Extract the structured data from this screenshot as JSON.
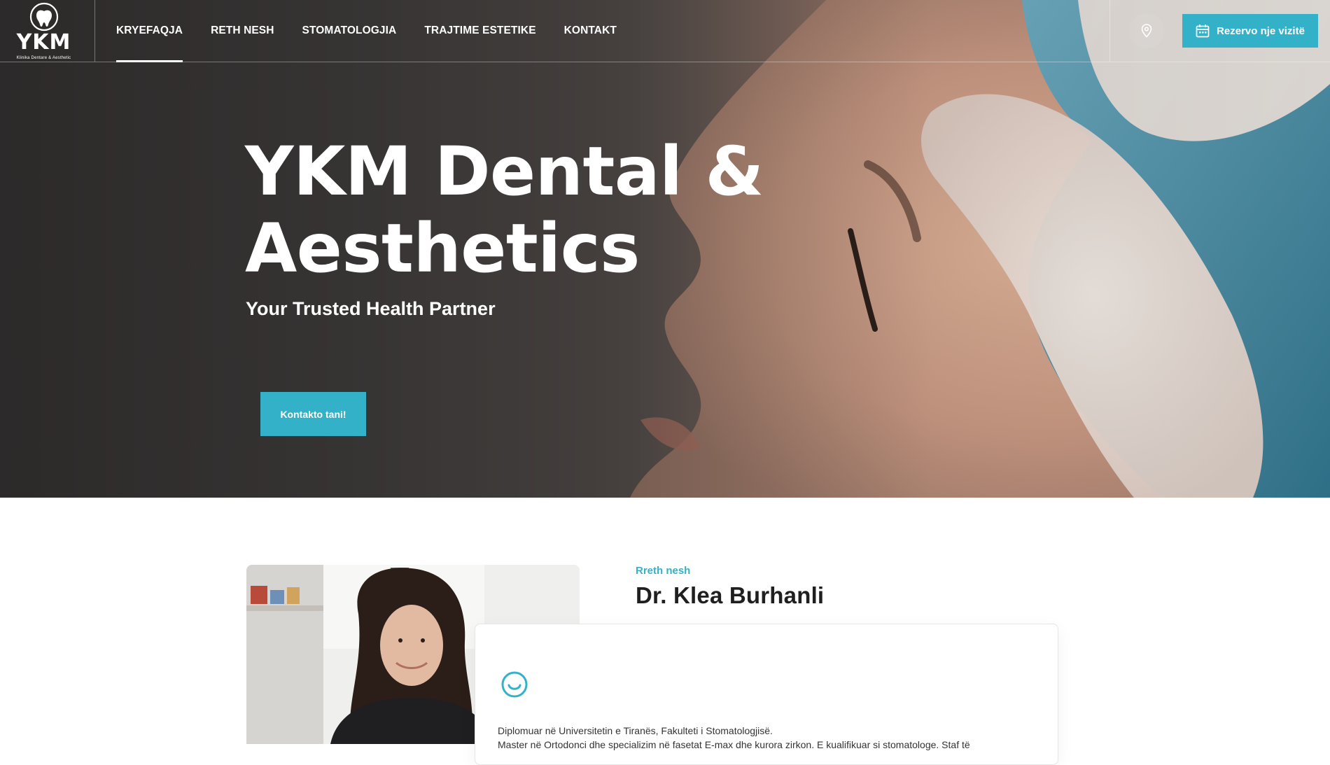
{
  "brand": {
    "logo_text": "YKM",
    "logo_sub": "Klinika Dentare & Aesthetic",
    "accent_color": "#33b1c9"
  },
  "nav": {
    "items": [
      {
        "label": "KRYEFAQJA",
        "active": true
      },
      {
        "label": "RETH NESH",
        "active": false
      },
      {
        "label": "STOMATOLOGJIA",
        "active": false
      },
      {
        "label": "TRAJTIME ESTETIKE",
        "active": false
      },
      {
        "label": "KONTAKT",
        "active": false
      }
    ]
  },
  "header": {
    "location_icon": "map-pin-icon",
    "book_icon": "calendar-icon",
    "book_label": "Rezervo nje vizitë"
  },
  "hero": {
    "title": "YKM Dental & Aesthetics",
    "subtitle": "Your Trusted Health Partner",
    "cta_label": "Kontakto tani!"
  },
  "about": {
    "label": "Rreth nesh",
    "name": "Dr. Klea Burhanli",
    "card_icon": "smile-icon",
    "text": "Diplomuar në Universitetin e Tiranës, Fakulteti i Stomatologjisë.",
    "text_partial": "Master në Ortodonci dhe specializim në fasetat E-max dhe kurora zirkon. E kualifikuar si stomatologe. Staf të"
  }
}
